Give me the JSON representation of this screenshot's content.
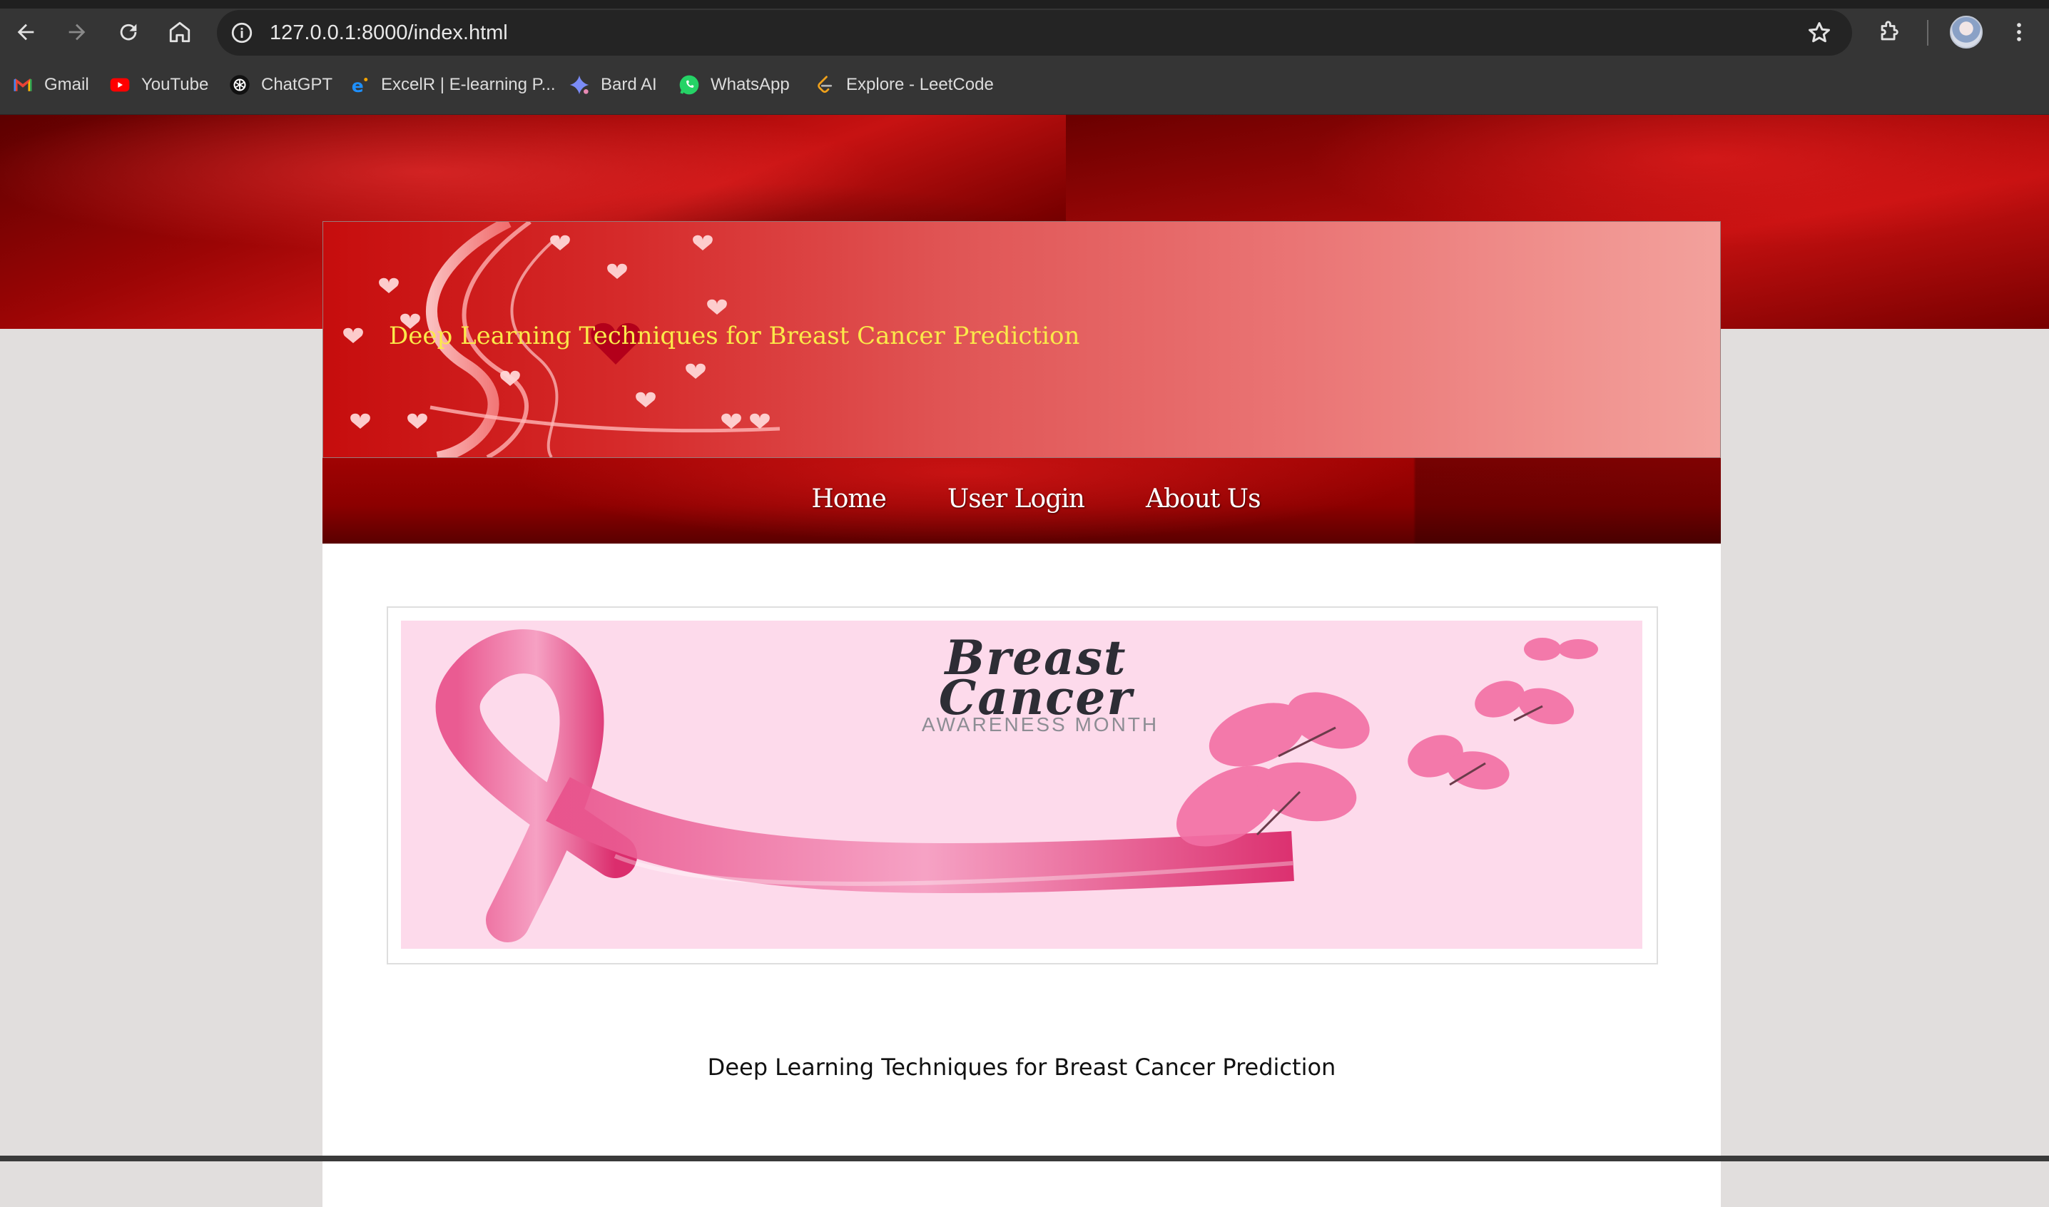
{
  "browser": {
    "url": "127.0.0.1:8000/index.html",
    "bookmarks": [
      {
        "label": "Gmail",
        "icon": "gmail-icon"
      },
      {
        "label": "YouTube",
        "icon": "youtube-icon"
      },
      {
        "label": "ChatGPT",
        "icon": "chatgpt-icon"
      },
      {
        "label": "ExcelR | E-learning P...",
        "icon": "excelr-icon"
      },
      {
        "label": "Bard AI",
        "icon": "bard-icon"
      },
      {
        "label": "WhatsApp",
        "icon": "whatsapp-icon"
      },
      {
        "label": "Explore - LeetCode",
        "icon": "leetcode-icon"
      }
    ]
  },
  "site": {
    "header_title": "Deep Learning Techniques for Breast Cancer Prediction",
    "nav": [
      {
        "label": "Home"
      },
      {
        "label": "User Login"
      },
      {
        "label": "About Us"
      }
    ],
    "banner": {
      "title_line1": "Breast",
      "title_line2": "Cancer",
      "subtitle": "AWARENESS MONTH"
    },
    "caption": "Deep Learning Techniques for Breast Cancer Prediction"
  },
  "colors": {
    "header_title": "#fbe94a",
    "ribbon": "#e2457a",
    "banner_bg": "#fddaeb"
  }
}
